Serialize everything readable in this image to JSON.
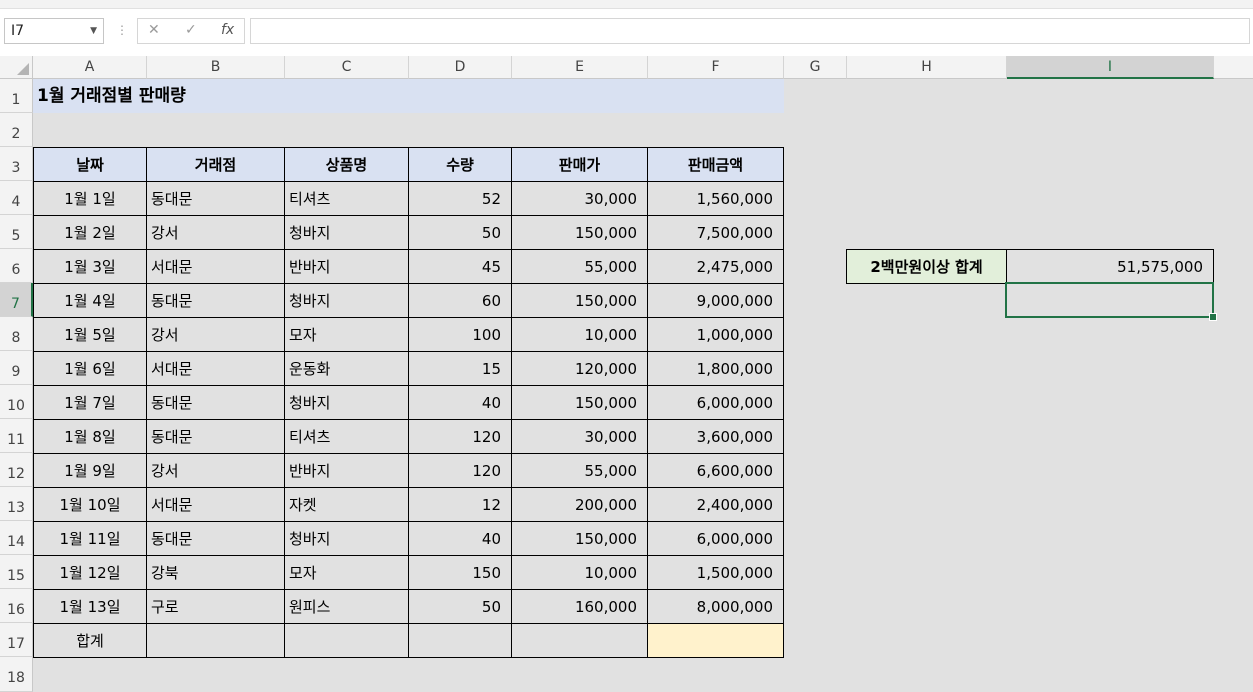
{
  "name_box": {
    "value": "I7"
  },
  "formula_bar": {
    "fx_label": "fx",
    "cancel": "✕",
    "enter": "✓",
    "content": ""
  },
  "columns": [
    "A",
    "B",
    "C",
    "D",
    "E",
    "F",
    "G",
    "H",
    "I"
  ],
  "rows": [
    "1",
    "2",
    "3",
    "4",
    "5",
    "6",
    "7",
    "8",
    "9",
    "10",
    "11",
    "12",
    "13",
    "14",
    "15",
    "16",
    "17",
    "18"
  ],
  "sheet": {
    "title": "1월 거래점별 판매량",
    "headers": [
      "날짜",
      "거래점",
      "상품명",
      "수량",
      "판매가",
      "판매금액"
    ],
    "data": [
      [
        "1월 1일",
        "동대문",
        "티셔츠",
        "52",
        "30,000",
        "1,560,000"
      ],
      [
        "1월 2일",
        "강서",
        "청바지",
        "50",
        "150,000",
        "7,500,000"
      ],
      [
        "1월 3일",
        "서대문",
        "반바지",
        "45",
        "55,000",
        "2,475,000"
      ],
      [
        "1월 4일",
        "동대문",
        "청바지",
        "60",
        "150,000",
        "9,000,000"
      ],
      [
        "1월 5일",
        "강서",
        "모자",
        "100",
        "10,000",
        "1,000,000"
      ],
      [
        "1월 6일",
        "서대문",
        "운동화",
        "15",
        "120,000",
        "1,800,000"
      ],
      [
        "1월 7일",
        "동대문",
        "청바지",
        "40",
        "150,000",
        "6,000,000"
      ],
      [
        "1월 8일",
        "동대문",
        "티셔츠",
        "120",
        "30,000",
        "3,600,000"
      ],
      [
        "1월 9일",
        "강서",
        "반바지",
        "120",
        "55,000",
        "6,600,000"
      ],
      [
        "1월 10일",
        "서대문",
        "자켓",
        "12",
        "200,000",
        "2,400,000"
      ],
      [
        "1월 11일",
        "동대문",
        "청바지",
        "40",
        "150,000",
        "6,000,000"
      ],
      [
        "1월 12일",
        "강북",
        "모자",
        "150",
        "10,000",
        "1,500,000"
      ],
      [
        "1월 13일",
        "구로",
        "원피스",
        "50",
        "160,000",
        "8,000,000"
      ]
    ],
    "total_label": "합계",
    "summary": {
      "label": "2백만원이상 합계",
      "value": "51,575,000"
    }
  },
  "colors": {
    "header_fill": "#d9e1f2",
    "total_fill": "#fff2cc",
    "summary_fill": "#e2efda",
    "accent": "#217346"
  }
}
